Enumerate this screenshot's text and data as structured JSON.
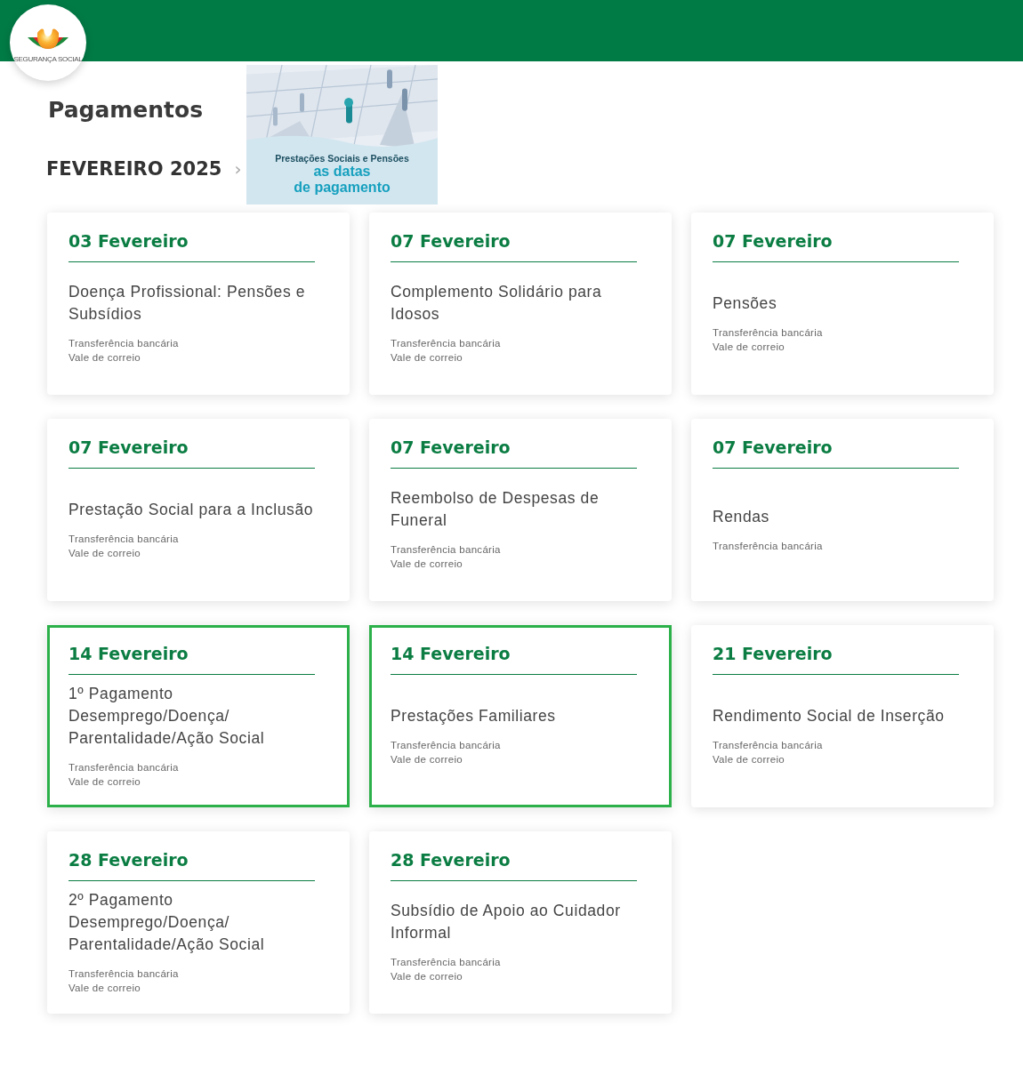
{
  "logo": {
    "text": "SEGURANÇA SOCIAL"
  },
  "page_title": "Pagamentos",
  "month": {
    "label": "FEVEREIRO 2025",
    "chevron": "›"
  },
  "banner": {
    "subtitle": "Prestações Sociais e Pensões",
    "title_line_1": "as datas",
    "title_line_2": "de pagamento"
  },
  "cards": [
    {
      "date": "03 Fevereiro",
      "title": "Doença Profissional: Pensões e Subsídios",
      "methods": [
        "Transferência bancária",
        "Vale de correio"
      ],
      "highlighted": false
    },
    {
      "date": "07 Fevereiro",
      "title": "Complemento Solidário para Idosos",
      "methods": [
        "Transferência bancária",
        "Vale de correio"
      ],
      "highlighted": false
    },
    {
      "date": "07 Fevereiro",
      "title": "Pensões",
      "methods": [
        "Transferência bancária",
        "Vale de correio"
      ],
      "highlighted": false
    },
    {
      "date": "07 Fevereiro",
      "title": "Prestação Social para a Inclusão",
      "methods": [
        "Transferência bancária",
        "Vale de correio"
      ],
      "highlighted": false
    },
    {
      "date": "07 Fevereiro",
      "title": "Reembolso de Despesas de Funeral",
      "methods": [
        "Transferência bancária",
        "Vale de correio"
      ],
      "highlighted": false
    },
    {
      "date": "07 Fevereiro",
      "title": "Rendas",
      "methods": [
        "Transferência bancária"
      ],
      "highlighted": false
    },
    {
      "date": "14 Fevereiro",
      "title": "1º Pagamento Desemprego/Doença/ Parentalidade/Ação Social",
      "methods": [
        "Transferência bancária",
        "Vale de correio"
      ],
      "highlighted": true
    },
    {
      "date": "14 Fevereiro",
      "title": "Prestações Familiares",
      "methods": [
        "Transferência bancária",
        "Vale de correio"
      ],
      "highlighted": true
    },
    {
      "date": "21 Fevereiro",
      "title": "Rendimento Social de Inserção",
      "methods": [
        "Transferência bancária",
        "Vale de correio"
      ],
      "highlighted": false
    },
    {
      "date": "28 Fevereiro",
      "title": "2º Pagamento Desemprego/Doença/ Parentalidade/Ação Social",
      "methods": [
        "Transferência bancária",
        "Vale de correio"
      ],
      "highlighted": false
    },
    {
      "date": "28 Fevereiro",
      "title": "Subsídio de Apoio ao Cuidador Informal",
      "methods": [
        "Transferência bancária",
        "Vale de correio"
      ],
      "highlighted": false
    }
  ]
}
